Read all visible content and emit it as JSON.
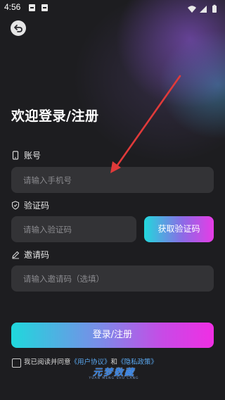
{
  "status_bar": {
    "time": "4:56",
    "icons": [
      "notification-box-icon",
      "a-app-icon",
      "notification-box-icon",
      "wifi-icon",
      "cellular-signal-icon",
      "battery-icon"
    ]
  },
  "header": {
    "back_icon": "back-arrow-icon"
  },
  "title": "欢迎登录/注册",
  "account": {
    "label": "账号",
    "icon": "phone-icon",
    "placeholder": "请输入手机号"
  },
  "verification": {
    "label": "验证码",
    "icon": "shield-check-icon",
    "placeholder": "请输入验证码",
    "button_label": "获取验证码"
  },
  "invite": {
    "label": "邀请码",
    "icon": "pencil-icon",
    "placeholder": "请输入邀请码（选填）"
  },
  "login_button_label": "登录/注册",
  "agreement": {
    "prefix": "我已阅读并同意",
    "user_agreement": "《用户协议》",
    "and": "和",
    "privacy_policy": "《隐私政策》",
    "checked": false
  },
  "watermark": {
    "main": "元梦数藏",
    "sub": "YUAN MENG SHU CANG"
  },
  "colors": {
    "background": "#1d1d20",
    "input_bg": "#333336",
    "gradient_start": "#1fd8dc",
    "gradient_end": "#f02ee4",
    "link": "#5aa8f0",
    "annotation_arrow": "#e03a3a"
  }
}
